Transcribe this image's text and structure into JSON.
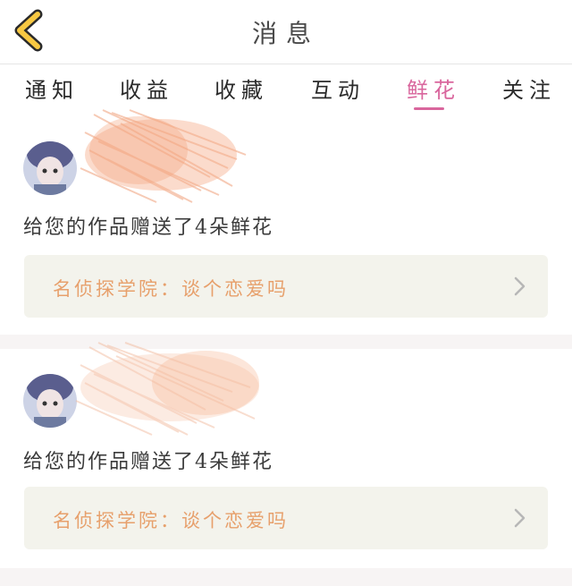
{
  "header": {
    "title": "消息",
    "back_icon": "chevron-left-icon",
    "accent": "#f7c842"
  },
  "tabs": [
    {
      "label": "通知",
      "active": false
    },
    {
      "label": "收益",
      "active": false
    },
    {
      "label": "收藏",
      "active": false
    },
    {
      "label": "互动",
      "active": false
    },
    {
      "label": "鲜花",
      "active": true
    },
    {
      "label": "关注",
      "active": false
    }
  ],
  "colors": {
    "active_tab": "#d9669d",
    "work_title": "#e7a06c",
    "card_bg": "#f3f3ec"
  },
  "messages": [
    {
      "text": "给您的作品赠送了4朵鲜花",
      "work_title": "名侦探学院：谈个恋爱吗"
    },
    {
      "text": "给您的作品赠送了4朵鲜花",
      "work_title": "名侦探学院：谈个恋爱吗"
    }
  ]
}
